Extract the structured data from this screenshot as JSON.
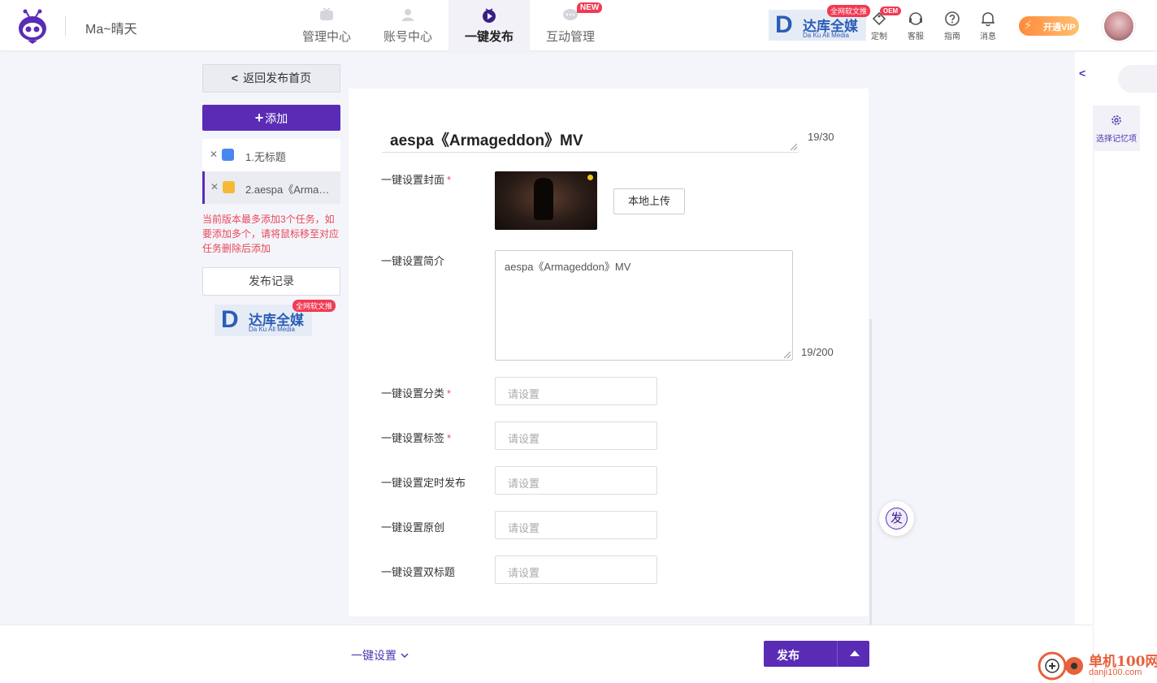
{
  "header": {
    "username": "Ma~晴天",
    "nav": [
      {
        "label": "管理中心",
        "icon": "tv-icon"
      },
      {
        "label": "账号中心",
        "icon": "account-icon"
      },
      {
        "label": "一键发布",
        "icon": "publish-play-icon"
      },
      {
        "label": "互动管理",
        "icon": "chat-icon",
        "badge": "NEW"
      }
    ],
    "brand": {
      "badge": "全网软文推",
      "name": "达库全媒",
      "sub": "Da Ku All Media"
    },
    "oem_badge": "OEM",
    "tools": [
      {
        "label": "定制",
        "icon": "custom-tag-icon"
      },
      {
        "label": "客服",
        "icon": "headset-icon"
      },
      {
        "label": "指南",
        "icon": "help-circle-icon"
      },
      {
        "label": "消息",
        "icon": "bell-icon"
      }
    ],
    "vip_label": "开通VIP"
  },
  "sidebar": {
    "back_label": "返回发布首页",
    "add_label": "添加",
    "tasks": [
      {
        "name": "1.无标题",
        "icon_color": "#4a86f0"
      },
      {
        "name": "2.aespa《Armageddon》MV",
        "icon_color": "#f5b935"
      }
    ],
    "warning": "当前版本最多添加3个任务，如要添加多个，请将鼠标移至对应任务删除后添加",
    "record_label": "发布记录",
    "brand": {
      "badge": "全网软文推",
      "name": "达库全媒",
      "sub": "Da Ku All Media"
    }
  },
  "form": {
    "title": "aespa《Armageddon》MV",
    "title_count": "19/30",
    "cover_label": "一键设置封面",
    "upload_label": "本地上传",
    "desc_label": "一键设置简介",
    "desc_value": "aespa《Armageddon》MV",
    "desc_count": "19/200",
    "fields": [
      {
        "label": "一键设置分类",
        "required": true,
        "placeholder": "请设置"
      },
      {
        "label": "一键设置标签",
        "required": true,
        "placeholder": "请设置"
      },
      {
        "label": "一键设置定时发布",
        "required": false,
        "placeholder": "请设置"
      },
      {
        "label": "一键设置原创",
        "required": false,
        "placeholder": "请设置"
      },
      {
        "label": "一键设置双标题",
        "required": false,
        "placeholder": "请设置"
      }
    ],
    "required_mark": "*",
    "fab_label": "发"
  },
  "drawer": {
    "memory_label": "选择记忆项"
  },
  "bottom": {
    "onekey_label": "一键设置",
    "publish_label": "发布"
  },
  "watermark": {
    "name": "单机100网",
    "url": "danji100.com"
  },
  "colors": {
    "accent": "#5a2cb5",
    "warning": "#e8485c",
    "brand_blue": "#2b5db7"
  }
}
